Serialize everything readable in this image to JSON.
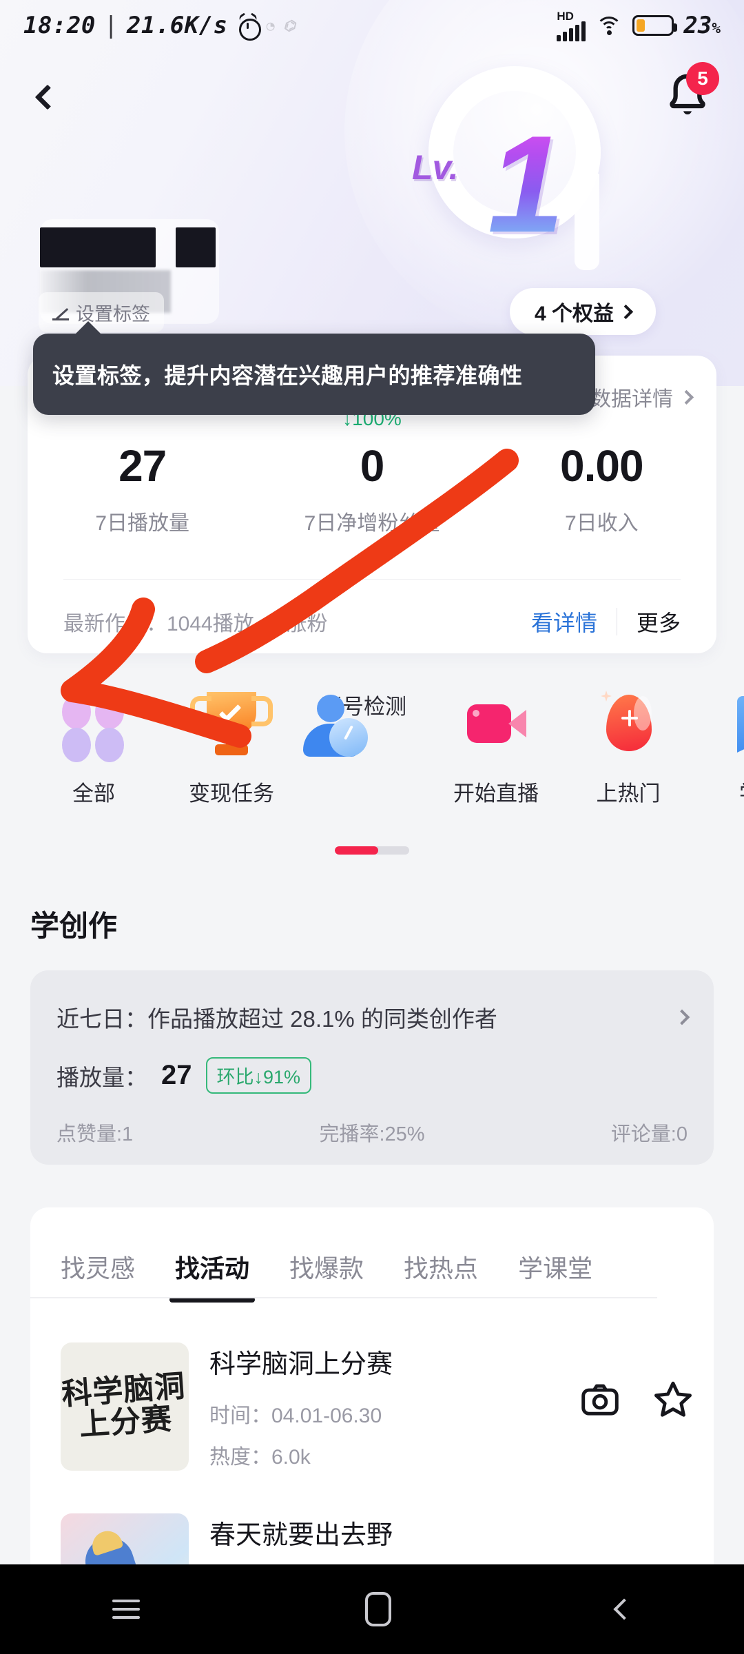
{
  "status_bar": {
    "time": "18:20",
    "separator": "|",
    "net_speed": "21.6K/s",
    "alarm_icon": "alarm-clock-icon",
    "hd_label": "HD",
    "signal_icon": "signal-bars-icon",
    "wifi_icon": "wifi-icon",
    "battery_icon": "battery-icon",
    "battery_pct": "23",
    "battery_pct_unit": "%"
  },
  "header": {
    "back_icon": "back-chevron-icon",
    "bell_icon": "bell-icon",
    "bell_badge": "5",
    "level_prefix": "Lv.",
    "level_value": "1",
    "benefits_label": "4 个权益",
    "benefits_arrow": "chevron-right-icon",
    "profile_name_redacted": "",
    "edit_label": "设置标签",
    "edit_icon": "pencil-icon"
  },
  "tooltip": {
    "text": "设置标签，提升内容潜在兴趣用户的推荐准确性"
  },
  "stat_card": {
    "detail_link": "数据详情",
    "detail_arrow": "chevron-right-icon",
    "stats": [
      {
        "value": "27",
        "label": "7日播放量",
        "delta": ""
      },
      {
        "value": "0",
        "label": "7日净增粉丝量",
        "delta": "↓100%"
      },
      {
        "value": "0.00",
        "label": "7日收入",
        "delta": ""
      }
    ],
    "delta_color": "#1ab675",
    "latest_work": "最新作品：1044播放，5涨粉",
    "see_detail": "看详情",
    "more": "更多",
    "see_detail_color": "#2a73d8"
  },
  "quick_actions": {
    "items": [
      {
        "label": "全部",
        "icon": "four-dots-icon",
        "badge": true
      },
      {
        "label": "变现任务",
        "icon": "trophy-icon",
        "badge": false
      },
      {
        "label": "账号检测",
        "icon": "account-check-icon",
        "badge": false
      },
      {
        "label": "开始直播",
        "icon": "video-camera-icon",
        "badge": false
      },
      {
        "label": "上热门",
        "icon": "boost-drop-icon",
        "badge": false
      },
      {
        "label": "学习",
        "icon": "book-icon",
        "badge": false
      }
    ],
    "carousel_indicator": "scroll-progress-bar"
  },
  "section": {
    "title": "学创作",
    "data_card": {
      "headline": "近七日：作品播放超过 28.1% 的同类创作者",
      "arrow": "chevron-right-icon",
      "plays_label": "播放量：",
      "plays_value": "27",
      "chip": "环比↓91%",
      "chip_color": "#2aa86d",
      "metrics": [
        "点赞量:1",
        "完播率:25%",
        "评论量:0"
      ]
    }
  },
  "tabs": {
    "items": [
      {
        "label": "找灵感",
        "active": false
      },
      {
        "label": "找活动",
        "active": true
      },
      {
        "label": "找爆款",
        "active": false
      },
      {
        "label": "找热点",
        "active": false
      },
      {
        "label": "学课堂",
        "active": false
      }
    ]
  },
  "activity_list": [
    {
      "title": "科学脑洞上分赛",
      "thumb_line1": "科学脑洞",
      "thumb_line2": "上分赛",
      "time_label": "时间：",
      "time_value": "04.01-06.30",
      "heat_label": "热度：",
      "heat_value": "6.0k",
      "camera_icon": "camera-icon",
      "star_icon": "star-outline-icon"
    },
    {
      "title": "春天就要出去野"
    }
  ],
  "navbar": {
    "recents_icon": "recents-icon",
    "home_icon": "home-icon",
    "back_icon": "back-icon"
  },
  "annotation": {
    "color": "#ee3a16",
    "shape": "hand-drawn-arrow"
  }
}
